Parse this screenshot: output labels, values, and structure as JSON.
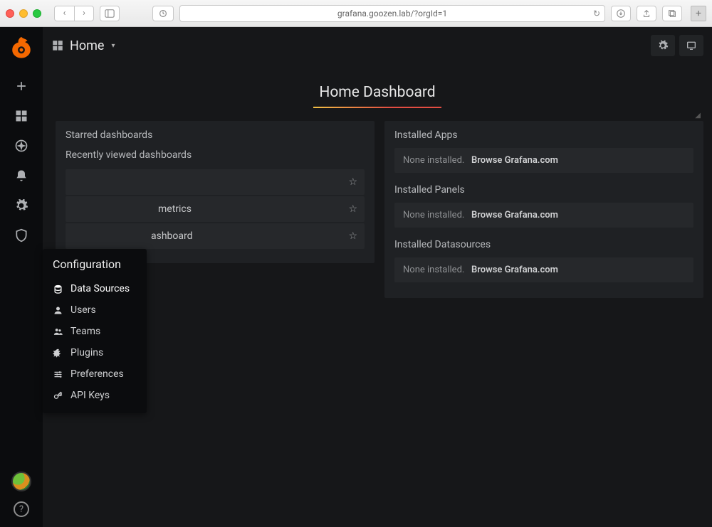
{
  "browser": {
    "url": "grafana.goozen.lab/?orgId=1"
  },
  "topbar": {
    "breadcrumb": "Home"
  },
  "hero": {
    "title": "Home Dashboard"
  },
  "left_panel": {
    "starred_title": "Starred dashboards",
    "recent_title": "Recently viewed dashboards",
    "rows": [
      {
        "label": ""
      },
      {
        "label": "metrics"
      },
      {
        "label": "ashboard"
      }
    ]
  },
  "right_panel": {
    "sections": [
      {
        "title": "Installed Apps",
        "none": "None installed.",
        "browse": "Browse Grafana.com"
      },
      {
        "title": "Installed Panels",
        "none": "None installed.",
        "browse": "Browse Grafana.com"
      },
      {
        "title": "Installed Datasources",
        "none": "None installed.",
        "browse": "Browse Grafana.com"
      }
    ]
  },
  "flyout": {
    "title": "Configuration",
    "items": [
      {
        "label": "Data Sources"
      },
      {
        "label": "Users"
      },
      {
        "label": "Teams"
      },
      {
        "label": "Plugins"
      },
      {
        "label": "Preferences"
      },
      {
        "label": "API Keys"
      }
    ]
  }
}
